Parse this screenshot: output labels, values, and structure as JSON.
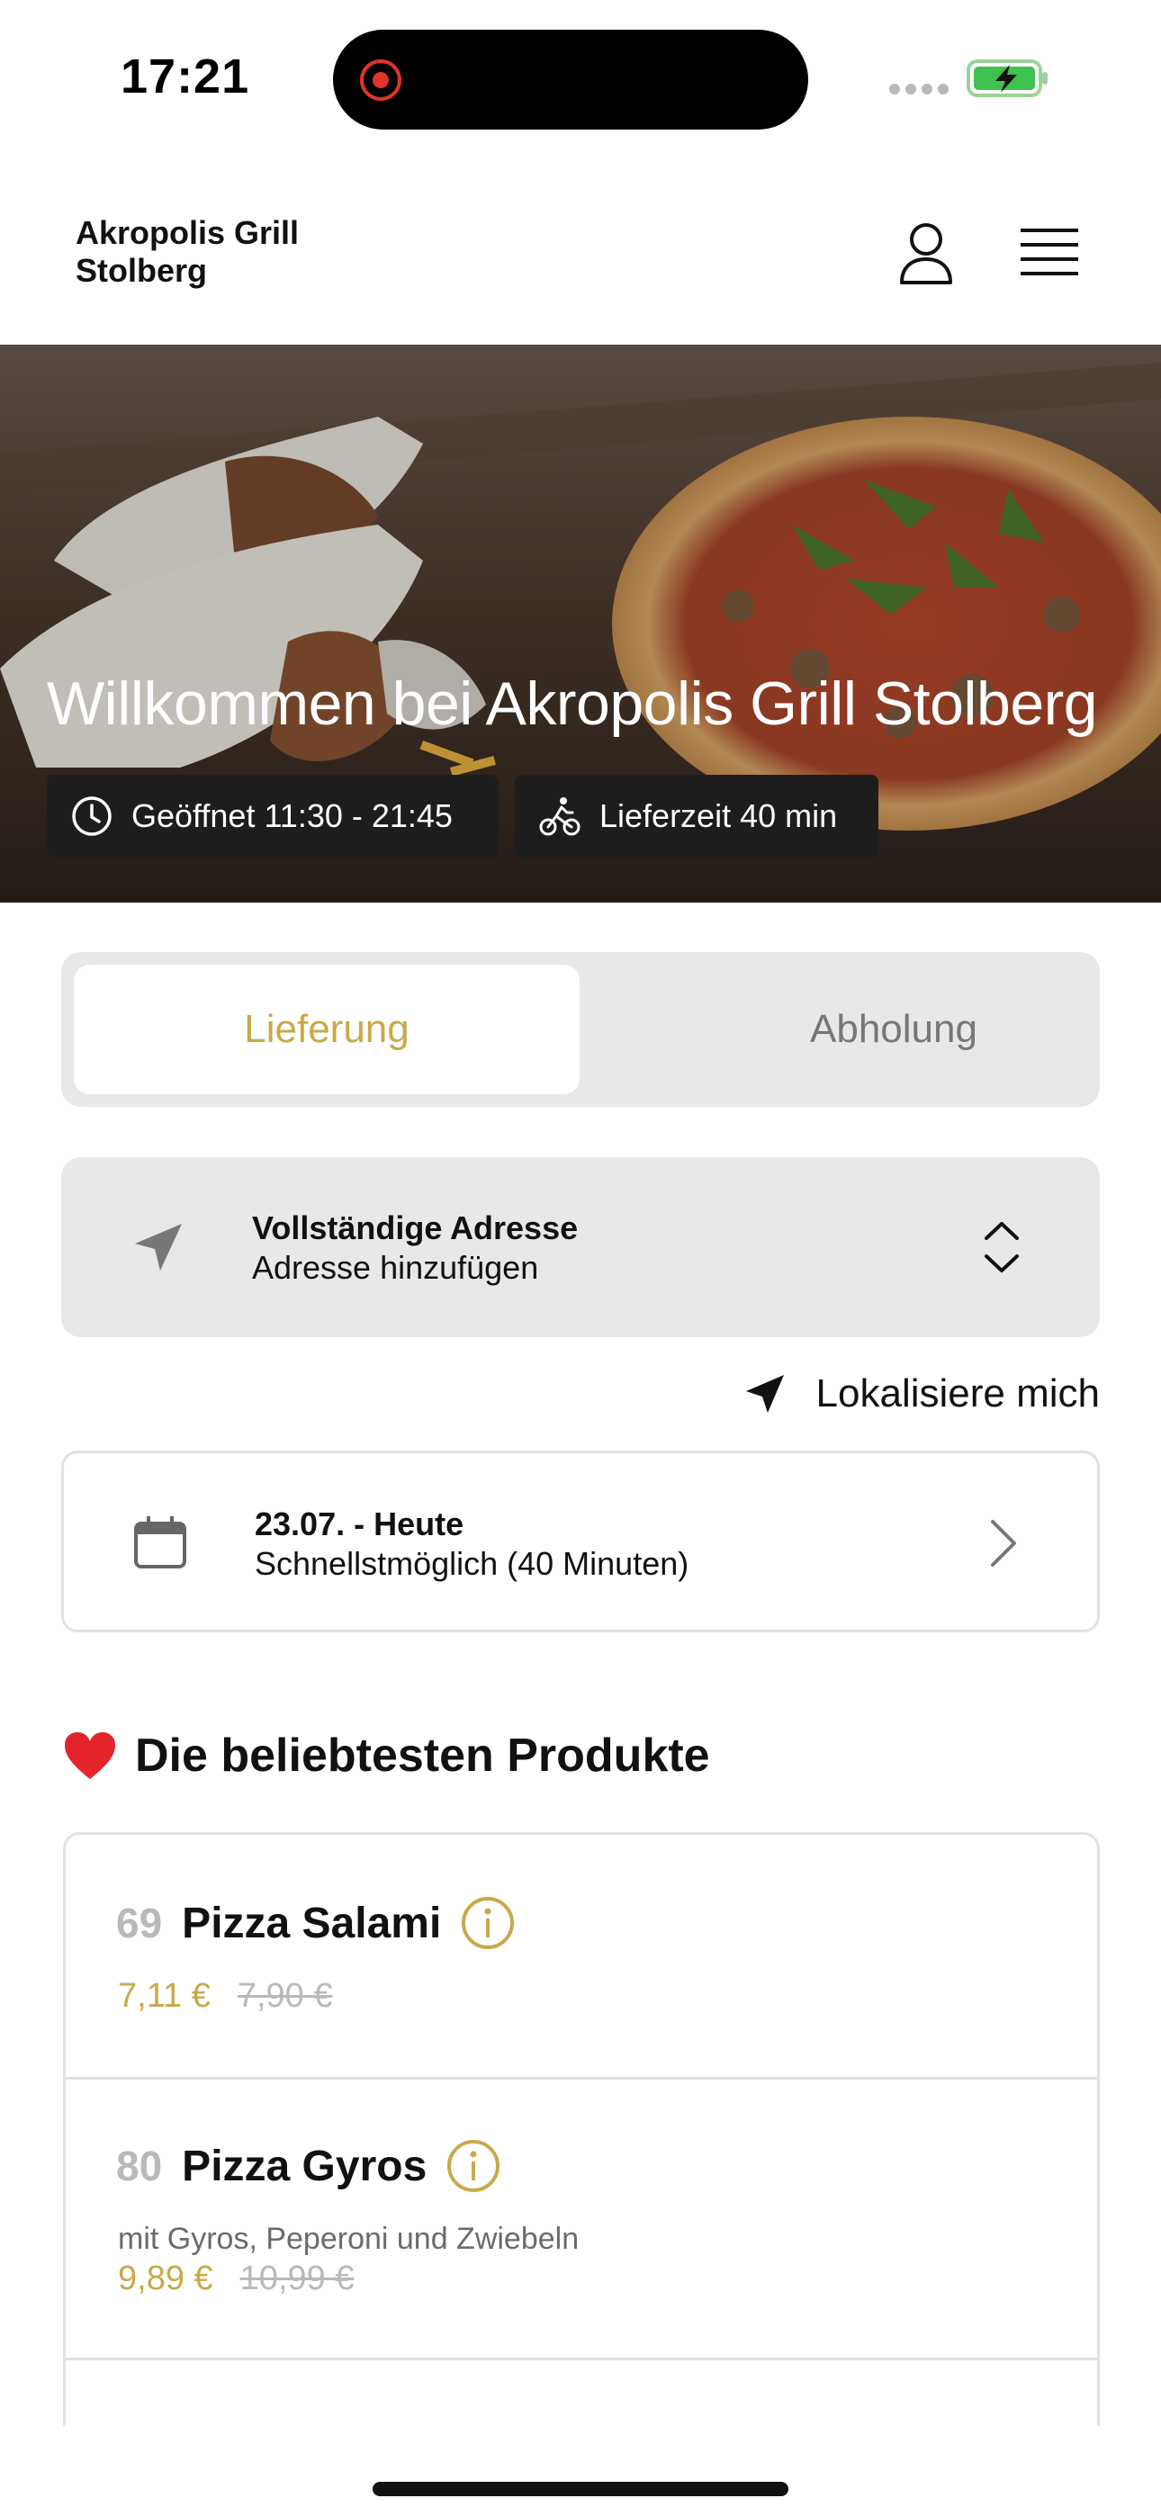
{
  "status_bar": {
    "time": "17:21"
  },
  "header": {
    "brand": "Akropolis Grill Stolberg"
  },
  "hero": {
    "title": "Willkommen bei Akropolis Grill Stolberg",
    "open_label": "Geöffnet 11:30 - 21:45",
    "delivery_label": "Lieferzeit 40 min"
  },
  "mode": {
    "options": [
      "Lieferung",
      "Abholung"
    ],
    "selected": "Lieferung"
  },
  "address": {
    "title": "Vollständige Adresse",
    "subtitle": "Adresse hinzufügen"
  },
  "locate": {
    "label": "Lokalisiere mich"
  },
  "schedule": {
    "date": "23.07. - Heute",
    "time": "Schnellstmöglich (40 Minuten)"
  },
  "popular": {
    "title": "Die beliebtesten Produkte",
    "products": [
      {
        "number": "69",
        "name": "Pizza Salami",
        "description": "",
        "price": "7,11 €",
        "old_price": "7,90 €"
      },
      {
        "number": "80",
        "name": "Pizza Gyros",
        "description": "mit Gyros, Peperoni und Zwiebeln",
        "price": "9,89 €",
        "old_price": "10,99 €"
      }
    ]
  },
  "colors": {
    "accent": "#c9a94a",
    "badge_bg": "#1d1d1d",
    "panel_bg": "#e8e8e8",
    "muted": "#b9b9b9"
  },
  "icons": [
    "record-icon",
    "battery-icon",
    "user-icon",
    "menu-icon",
    "clock-icon",
    "bicycle-icon",
    "navigation-arrow-icon",
    "chevron-updown-icon",
    "calendar-icon",
    "chevron-right-icon",
    "heart-icon",
    "info-icon"
  ]
}
